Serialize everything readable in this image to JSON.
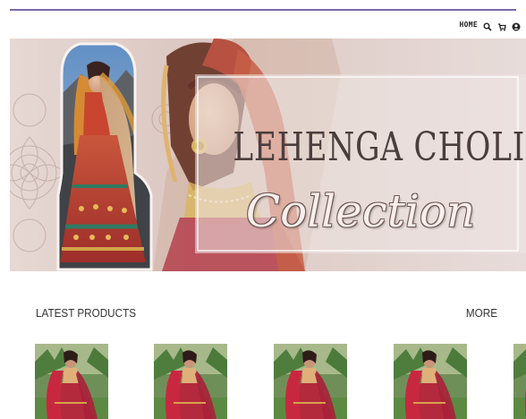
{
  "nav": {
    "home_label": "HOME",
    "icons": [
      "search-icon",
      "cart-icon",
      "user-icon"
    ]
  },
  "banner": {
    "title": "LEHENGA CHOLI",
    "subtitle": "Collection"
  },
  "section": {
    "title": "LATEST PRODUCTS",
    "more_label": "MORE"
  },
  "products": [
    {
      "image": "lehenga-model-photo"
    },
    {
      "image": "lehenga-model-photo"
    },
    {
      "image": "lehenga-model-photo"
    },
    {
      "image": "lehenga-model-photo"
    },
    {
      "image": "lehenga-model-photo"
    }
  ],
  "colors": {
    "accent_rule": "#7a68a8",
    "banner_bg": "#e2d3cf",
    "lehenga_red": "#b32a3c",
    "dupatta_gold": "#d9923a"
  }
}
